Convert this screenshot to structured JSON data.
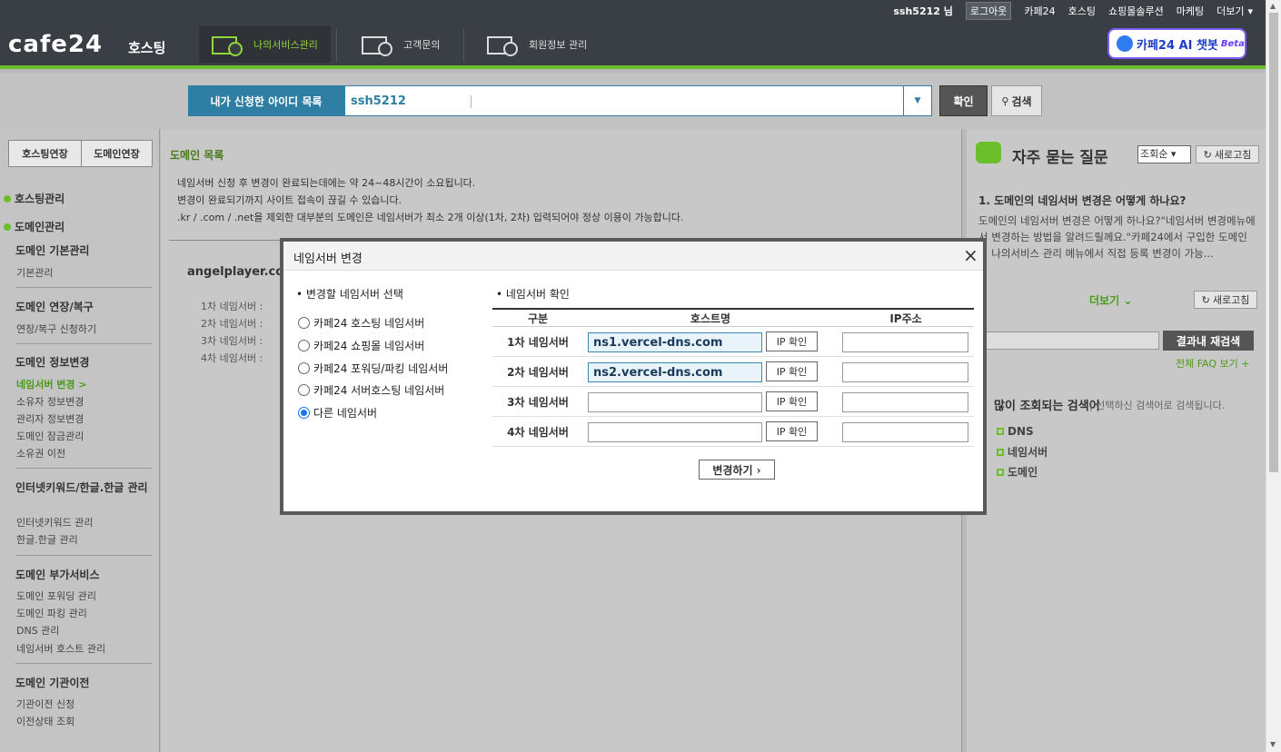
{
  "topbar": {
    "user": "ssh5212 님",
    "logout": "로그아웃",
    "links": [
      "카페24",
      "호스팅",
      "쇼핑몰솔루션",
      "마케팅",
      "더보기"
    ]
  },
  "header": {
    "logo": "cafe24",
    "logo_sub": "호스팅",
    "nav": [
      "나의서비스관리",
      "고객문의",
      "회원정보 관리"
    ],
    "chatbot": "카페24 AI 챗봇",
    "chatbot_beta": "Beta"
  },
  "search": {
    "label": "내가 신청한 아이디 목록",
    "value": "ssh5212",
    "confirm": "확인",
    "search": "검색"
  },
  "sidebar": {
    "btn_hosting": "호스팅연장",
    "btn_domain": "도메인연장",
    "h_hosting": "호스팅관리",
    "h_domain": "도메인관리",
    "groups": [
      {
        "title": "도메인 기본관리",
        "items": [
          "기본관리"
        ]
      },
      {
        "title": "도메인 연장/복구",
        "items": [
          "연장/복구 신청하기"
        ]
      },
      {
        "title": "도메인 정보변경",
        "items": [
          "네임서버 변경 >",
          "소유자 정보변경",
          "관리자 정보변경",
          "도메인 잠금관리",
          "소유권 이전"
        ]
      },
      {
        "title": "인터넷키워드/한글.한글 관리",
        "items": [
          "인터넷키워드 관리",
          "한글.한글 관리"
        ]
      },
      {
        "title": "도메인 부가서비스",
        "items": [
          "도메인 포워딩 관리",
          "도메인 파킹 관리",
          "DNS 관리",
          "네임서버 호스트 관리"
        ]
      },
      {
        "title": "도메인 기관이전",
        "items": [
          "기관이전 신청",
          "이전상태 조회"
        ]
      }
    ]
  },
  "main": {
    "title": "도메인 목록",
    "notes": [
      "네임서버 신청 후 변경이 완료되는데에는 약 24~48시간이 소요됩니다.",
      "변경이 완료되기까지 사이트 접속이 끊길 수 있습니다.",
      ".kr / .com / .net을 제외한 대부분의 도메인은 네임서버가 최소 2개 이상(1차, 2차) 입력되어야 정상 이용이 가능합니다."
    ],
    "domain": "angelplayer.co.",
    "ns_rows": [
      "1차 네임서버 :",
      "2차 네임서버 :",
      "3차 네임서버 :",
      "4차 네임서버 :"
    ]
  },
  "right": {
    "faq_title": "자주 묻는 질문",
    "sort": "조회순",
    "refresh": "새로고침",
    "question": "1. 도메인의 네임서버 변경은 어떻게 하나요?",
    "answer": "도메인의 네임서버 변경은 어떻게 하나요?\"네임서버 변경메뉴에서 변경하는 방법을 알려드릴께요.\"카페24에서 구입한 도메인의 나의서비스 관리 메뉴에서 직접 등록 변경이 가능...",
    "more": "더보기",
    "refresh2": "새로고침",
    "research": "결과내 재검색",
    "all_faq": "전체 FAQ 보기 +",
    "popular": "많이 조회되는 검색어",
    "popular_sub": "| 선택하신 검색어로 검색됩니다.",
    "keywords": [
      "DNS",
      "네임서버",
      "도메인"
    ]
  },
  "modal": {
    "title": "네임서버 변경",
    "left_title": "• 변경할 네임서버 선택",
    "right_title": "• 네임서버 확인",
    "options": [
      "카페24 호스팅 네임서버",
      "카페24 쇼핑몰 네임서버",
      "카페24 포워딩/파킹 네임서버",
      "카페24 서버호스팅 네임서버",
      "다른 네임서버"
    ],
    "selected_index": 4,
    "col_div": "구분",
    "col_host": "호스트명",
    "col_ip": "IP주소",
    "rows": [
      {
        "label": "1차 네임서버",
        "host": "ns1.vercel-dns.com",
        "ip": ""
      },
      {
        "label": "2차 네임서버",
        "host": "ns2.vercel-dns.com",
        "ip": ""
      },
      {
        "label": "3차 네임서버",
        "host": "",
        "ip": ""
      },
      {
        "label": "4차 네임서버",
        "host": "",
        "ip": ""
      }
    ],
    "ip_btn": "IP 확인",
    "submit": "변경하기 ›"
  }
}
